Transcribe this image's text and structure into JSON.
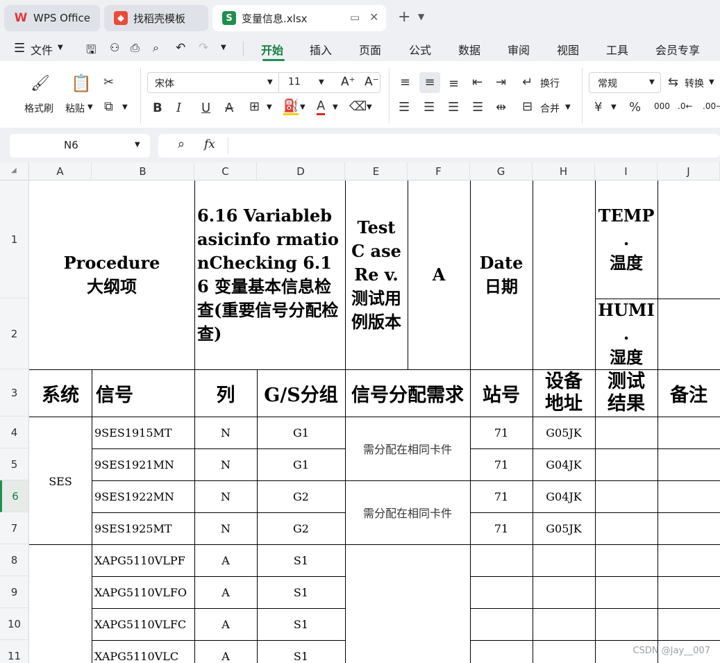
{
  "tabs": {
    "wps": "WPS Office",
    "template": "找稻壳模板",
    "file": "变量信息.xlsx",
    "new_tab": "+"
  },
  "menu": {
    "file": "文件",
    "items": [
      "开始",
      "插入",
      "页面",
      "公式",
      "数据",
      "审阅",
      "视图",
      "工具",
      "会员专享"
    ]
  },
  "ribbon": {
    "format_painter": "格式刷",
    "paste": "粘贴",
    "font_name": "宋体",
    "font_size": "11",
    "wrap": "换行",
    "merge": "合并",
    "number_format": "常规",
    "convert": "转换"
  },
  "formula_bar": {
    "cell_ref": "N6",
    "fx": "fx"
  },
  "columns": [
    "A",
    "B",
    "C",
    "D",
    "E",
    "F",
    "G",
    "H",
    "I",
    "J"
  ],
  "rows": [
    "1",
    "2",
    "3",
    "4",
    "5",
    "6",
    "7",
    "8",
    "9",
    "10",
    "11"
  ],
  "header1": {
    "procedure": "Procedure\n大纲项",
    "title": "6.16 Variablebasicinfo rmationChecking 6.16 变量基本信息检查(重要信号分配检查)",
    "testcase": "TestC aseRe v.\n测试用例版本",
    "version": "A",
    "date": "Date\n日期",
    "temp": "TEMP\n.\n温度",
    "humi": "HUMI\n.\n湿度"
  },
  "header3": [
    "系统",
    "信号",
    "列",
    "G/S分组",
    "信号分配需求",
    "站号",
    "设备地址",
    "测试结果",
    "备注"
  ],
  "system_ses": "SES",
  "req_note": "需分配在相同卡件",
  "data_rows": [
    {
      "signal": "9SES1915MT",
      "col": "N",
      "group": "G1",
      "station": "71",
      "addr": "G05JK"
    },
    {
      "signal": "9SES1921MN",
      "col": "N",
      "group": "G1",
      "station": "71",
      "addr": "G04JK"
    },
    {
      "signal": "9SES1922MN",
      "col": "N",
      "group": "G2",
      "station": "71",
      "addr": "G04JK"
    },
    {
      "signal": "9SES1925MT",
      "col": "N",
      "group": "G2",
      "station": "71",
      "addr": "G05JK"
    },
    {
      "signal": "XAPG5110VLPF",
      "col": "A",
      "group": "S1",
      "station": "",
      "addr": ""
    },
    {
      "signal": "XAPG5110VLFO",
      "col": "A",
      "group": "S1",
      "station": "",
      "addr": ""
    },
    {
      "signal": "XAPG5110VLFC",
      "col": "A",
      "group": "S1",
      "station": "",
      "addr": ""
    },
    {
      "signal": "XAPG5110VLC",
      "col": "A",
      "group": "S1",
      "station": "",
      "addr": ""
    }
  ],
  "watermark": "CSDN @Jay__007"
}
